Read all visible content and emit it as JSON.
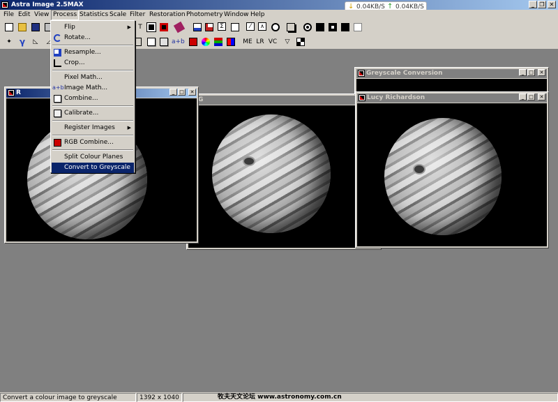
{
  "app": {
    "title": "Astra Image 2.5MAX"
  },
  "net": {
    "down": "0.04KB/S",
    "up": "0.04KB/S"
  },
  "menubar": [
    "File",
    "Edit",
    "View",
    "Process",
    "Statistics",
    "Scale",
    "Filter",
    "Restoration",
    "Photometry",
    "Window",
    "Help"
  ],
  "process_menu": {
    "items": [
      {
        "label": "Flip",
        "icon": "flip-icon",
        "submenu": true
      },
      {
        "label": "Rotate...",
        "icon": "rotate-icon"
      },
      {
        "label": "Resample...",
        "icon": "resample-icon"
      },
      {
        "label": "Crop...",
        "icon": "crop-icon"
      },
      {
        "label": "Pixel Math..."
      },
      {
        "label": "Image Math...",
        "icon": "image-math-icon",
        "icon_text": "a+b"
      },
      {
        "label": "Combine...",
        "icon": "combine-icon"
      },
      {
        "label": "Calibrate...",
        "icon": "calibrate-icon"
      },
      {
        "label": "Register Images",
        "submenu": true
      },
      {
        "label": "RGB Combine...",
        "icon": "rgb-combine-icon"
      },
      {
        "label": "Split Colour Planes"
      },
      {
        "label": "Convert to Greyscale",
        "selected": true
      }
    ]
  },
  "toolbar": {
    "me": "ME",
    "lr": "LR",
    "vc": "VC",
    "ab": "a+b",
    "gamma": "γ"
  },
  "windows": {
    "r": {
      "title": "R"
    },
    "g": {
      "title": "G"
    },
    "greyscale": {
      "title": "Greyscale Conversion"
    },
    "lucy": {
      "title": "Lucy Richardson"
    }
  },
  "status": {
    "message": "Convert a colour image to greyscale",
    "dimensions": "1392 x 1040",
    "watermark": "牧夫天文论坛 www.astronomy.com.cn"
  },
  "colors": {
    "titlebar_active": "#0a246a",
    "face": "#d4d0c8",
    "workspace": "#808080"
  }
}
